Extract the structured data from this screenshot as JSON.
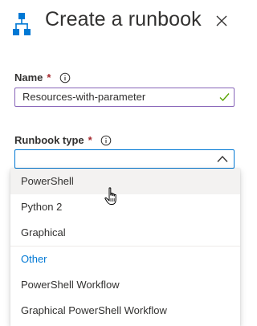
{
  "panel": {
    "title": "Create a runbook",
    "icon": "runbook-hierarchy-icon",
    "accent_color": "#0078d4"
  },
  "form": {
    "name": {
      "label": "Name",
      "required_marker": "*",
      "value": "Resources-with-parameter",
      "valid": true
    },
    "runbook_type": {
      "label": "Runbook type",
      "required_marker": "*",
      "value": "",
      "expanded": true
    }
  },
  "dropdown": {
    "options": [
      {
        "label": "PowerShell",
        "hovered": true
      },
      {
        "label": "Python 2"
      },
      {
        "label": "Graphical"
      }
    ],
    "group_header": "Other",
    "group_options": [
      {
        "label": "PowerShell Workflow"
      },
      {
        "label": "Graphical PowerShell Workflow"
      }
    ]
  }
}
